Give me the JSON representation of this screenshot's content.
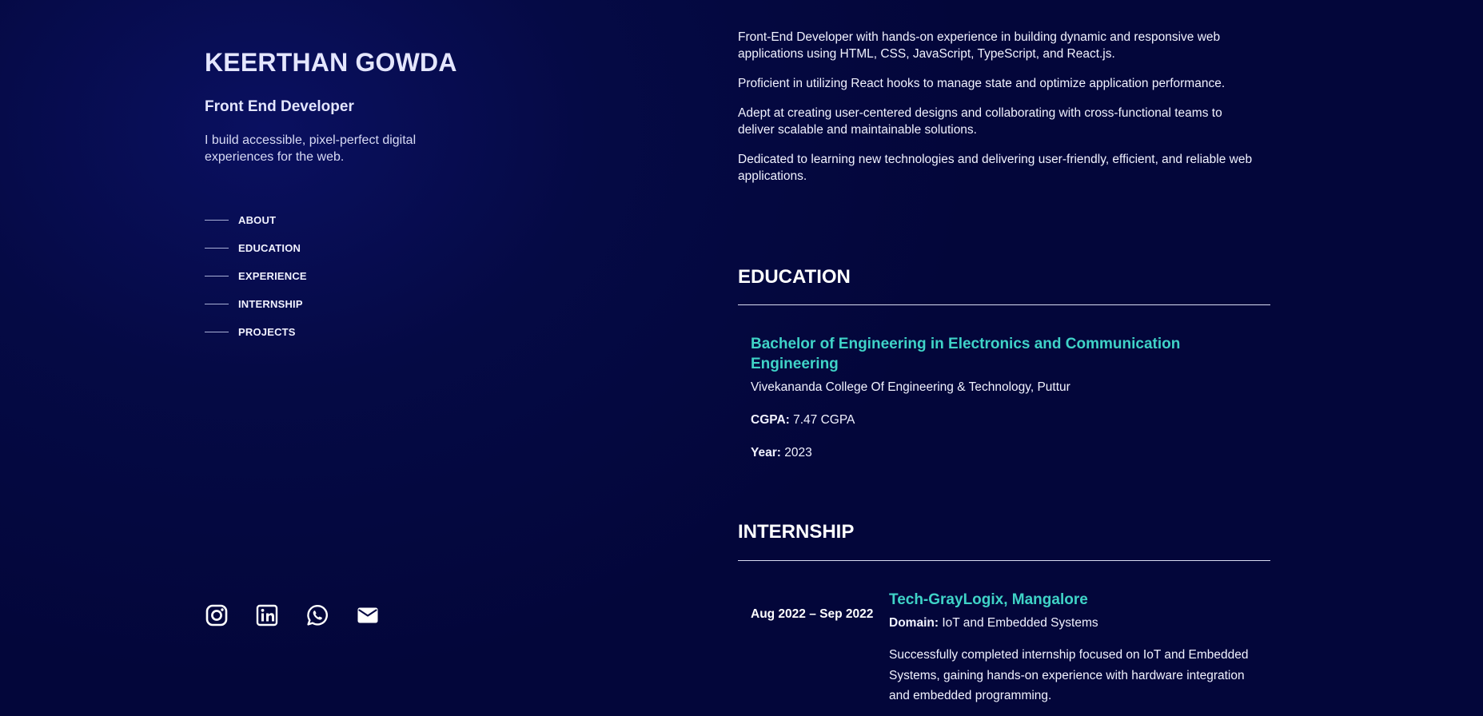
{
  "profile": {
    "name": "KEERTHAN GOWDA",
    "role": "Front End Developer",
    "tagline": "I build accessible, pixel-perfect digital experiences for the web."
  },
  "nav": {
    "items": [
      {
        "label": "ABOUT"
      },
      {
        "label": "EDUCATION"
      },
      {
        "label": "EXPERIENCE"
      },
      {
        "label": "INTERNSHIP"
      },
      {
        "label": "PROJECTS"
      }
    ]
  },
  "socials": {
    "icons": [
      "instagram-icon",
      "linkedin-icon",
      "whatsapp-icon",
      "mail-icon"
    ]
  },
  "about": {
    "paragraphs": [
      "Front-End Developer with hands-on experience in building dynamic and responsive web applications using HTML, CSS, JavaScript, TypeScript, and React.js.",
      "Proficient in utilizing React hooks to manage state and optimize application performance.",
      "Adept at creating user-centered designs and collaborating with cross-functional teams to deliver scalable and maintainable solutions.",
      "Dedicated to learning new technologies and delivering user-friendly, efficient, and reliable web applications."
    ]
  },
  "education": {
    "title": "EDUCATION",
    "degree": "Bachelor of Engineering in Electronics and Communication Engineering",
    "college": "Vivekananda College Of Engineering & Technology, Puttur",
    "cgpa_label": "CGPA:",
    "cgpa_value": "7.47 CGPA",
    "year_label": "Year:",
    "year_value": "2023"
  },
  "internship": {
    "title": "INTERNSHIP",
    "date": "Aug 2022 – Sep 2022",
    "company": "Tech-GrayLogix, Mangalore",
    "domain_label": "Domain:",
    "domain_value": "IoT and Embedded Systems",
    "description": "Successfully completed internship focused on IoT and Embedded Systems, gaining hands-on experience with hardware integration and embedded programming."
  },
  "colors": {
    "background": "#03063a",
    "accent": "#3fd3c7",
    "text": "#f1f2ff"
  }
}
